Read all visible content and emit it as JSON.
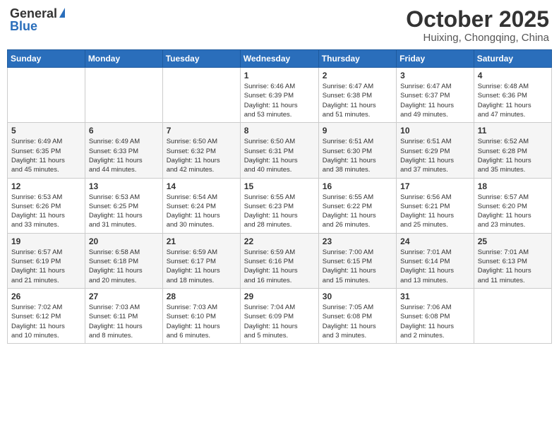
{
  "header": {
    "logo_general": "General",
    "logo_blue": "Blue",
    "month_title": "October 2025",
    "location": "Huixing, Chongqing, China"
  },
  "weekdays": [
    "Sunday",
    "Monday",
    "Tuesday",
    "Wednesday",
    "Thursday",
    "Friday",
    "Saturday"
  ],
  "weeks": [
    [
      {
        "day": "",
        "info": ""
      },
      {
        "day": "",
        "info": ""
      },
      {
        "day": "",
        "info": ""
      },
      {
        "day": "1",
        "info": "Sunrise: 6:46 AM\nSunset: 6:39 PM\nDaylight: 11 hours\nand 53 minutes."
      },
      {
        "day": "2",
        "info": "Sunrise: 6:47 AM\nSunset: 6:38 PM\nDaylight: 11 hours\nand 51 minutes."
      },
      {
        "day": "3",
        "info": "Sunrise: 6:47 AM\nSunset: 6:37 PM\nDaylight: 11 hours\nand 49 minutes."
      },
      {
        "day": "4",
        "info": "Sunrise: 6:48 AM\nSunset: 6:36 PM\nDaylight: 11 hours\nand 47 minutes."
      }
    ],
    [
      {
        "day": "5",
        "info": "Sunrise: 6:49 AM\nSunset: 6:35 PM\nDaylight: 11 hours\nand 45 minutes."
      },
      {
        "day": "6",
        "info": "Sunrise: 6:49 AM\nSunset: 6:33 PM\nDaylight: 11 hours\nand 44 minutes."
      },
      {
        "day": "7",
        "info": "Sunrise: 6:50 AM\nSunset: 6:32 PM\nDaylight: 11 hours\nand 42 minutes."
      },
      {
        "day": "8",
        "info": "Sunrise: 6:50 AM\nSunset: 6:31 PM\nDaylight: 11 hours\nand 40 minutes."
      },
      {
        "day": "9",
        "info": "Sunrise: 6:51 AM\nSunset: 6:30 PM\nDaylight: 11 hours\nand 38 minutes."
      },
      {
        "day": "10",
        "info": "Sunrise: 6:51 AM\nSunset: 6:29 PM\nDaylight: 11 hours\nand 37 minutes."
      },
      {
        "day": "11",
        "info": "Sunrise: 6:52 AM\nSunset: 6:28 PM\nDaylight: 11 hours\nand 35 minutes."
      }
    ],
    [
      {
        "day": "12",
        "info": "Sunrise: 6:53 AM\nSunset: 6:26 PM\nDaylight: 11 hours\nand 33 minutes."
      },
      {
        "day": "13",
        "info": "Sunrise: 6:53 AM\nSunset: 6:25 PM\nDaylight: 11 hours\nand 31 minutes."
      },
      {
        "day": "14",
        "info": "Sunrise: 6:54 AM\nSunset: 6:24 PM\nDaylight: 11 hours\nand 30 minutes."
      },
      {
        "day": "15",
        "info": "Sunrise: 6:55 AM\nSunset: 6:23 PM\nDaylight: 11 hours\nand 28 minutes."
      },
      {
        "day": "16",
        "info": "Sunrise: 6:55 AM\nSunset: 6:22 PM\nDaylight: 11 hours\nand 26 minutes."
      },
      {
        "day": "17",
        "info": "Sunrise: 6:56 AM\nSunset: 6:21 PM\nDaylight: 11 hours\nand 25 minutes."
      },
      {
        "day": "18",
        "info": "Sunrise: 6:57 AM\nSunset: 6:20 PM\nDaylight: 11 hours\nand 23 minutes."
      }
    ],
    [
      {
        "day": "19",
        "info": "Sunrise: 6:57 AM\nSunset: 6:19 PM\nDaylight: 11 hours\nand 21 minutes."
      },
      {
        "day": "20",
        "info": "Sunrise: 6:58 AM\nSunset: 6:18 PM\nDaylight: 11 hours\nand 20 minutes."
      },
      {
        "day": "21",
        "info": "Sunrise: 6:59 AM\nSunset: 6:17 PM\nDaylight: 11 hours\nand 18 minutes."
      },
      {
        "day": "22",
        "info": "Sunrise: 6:59 AM\nSunset: 6:16 PM\nDaylight: 11 hours\nand 16 minutes."
      },
      {
        "day": "23",
        "info": "Sunrise: 7:00 AM\nSunset: 6:15 PM\nDaylight: 11 hours\nand 15 minutes."
      },
      {
        "day": "24",
        "info": "Sunrise: 7:01 AM\nSunset: 6:14 PM\nDaylight: 11 hours\nand 13 minutes."
      },
      {
        "day": "25",
        "info": "Sunrise: 7:01 AM\nSunset: 6:13 PM\nDaylight: 11 hours\nand 11 minutes."
      }
    ],
    [
      {
        "day": "26",
        "info": "Sunrise: 7:02 AM\nSunset: 6:12 PM\nDaylight: 11 hours\nand 10 minutes."
      },
      {
        "day": "27",
        "info": "Sunrise: 7:03 AM\nSunset: 6:11 PM\nDaylight: 11 hours\nand 8 minutes."
      },
      {
        "day": "28",
        "info": "Sunrise: 7:03 AM\nSunset: 6:10 PM\nDaylight: 11 hours\nand 6 minutes."
      },
      {
        "day": "29",
        "info": "Sunrise: 7:04 AM\nSunset: 6:09 PM\nDaylight: 11 hours\nand 5 minutes."
      },
      {
        "day": "30",
        "info": "Sunrise: 7:05 AM\nSunset: 6:08 PM\nDaylight: 11 hours\nand 3 minutes."
      },
      {
        "day": "31",
        "info": "Sunrise: 7:06 AM\nSunset: 6:08 PM\nDaylight: 11 hours\nand 2 minutes."
      },
      {
        "day": "",
        "info": ""
      }
    ]
  ]
}
